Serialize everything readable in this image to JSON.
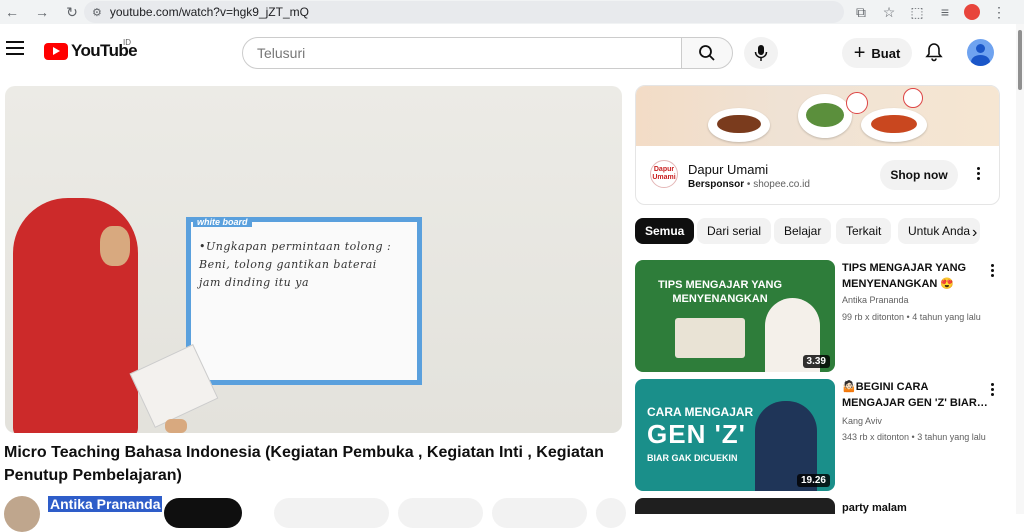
{
  "browser": {
    "url": "youtube.com/watch?v=hgk9_jZT_mQ"
  },
  "header": {
    "logo_text": "YouTube",
    "region": "ID",
    "search_placeholder": "Telusuri",
    "create_label": "Buat"
  },
  "video": {
    "title": "Micro Teaching Bahasa Indonesia (Kegiatan Pembuka , Kegiatan Inti , Kegiatan Penutup Pembelajaran)",
    "channel": "Antika Prananda",
    "whiteboard_label": "white board",
    "whiteboard_lines": [
      "•Ungkapan permintaan tolong :",
      "Beni, tolong gantikan baterai",
      "jam dinding itu ya"
    ]
  },
  "ad": {
    "logo_text": "Dapur Umami",
    "title": "Dapur Umami",
    "sponsor_label": "Bersponsor",
    "domain": "shopee.co.id",
    "cta": "Shop now"
  },
  "chips": [
    "Semua",
    "Dari serial",
    "Belajar",
    "Terkait",
    "Untuk Anda"
  ],
  "recommendations": [
    {
      "thumb_text": "TIPS MENGAJAR YANG MENYENANGKAN",
      "title": "TIPS MENGAJAR YANG MENYENANGKAN 😍",
      "channel": "Antika Prananda",
      "meta": "99 rb x ditonton • 4 tahun yang lalu",
      "duration": "3.39",
      "colors": {
        "bg": "#2e7d3a",
        "band": "#f5d33b"
      }
    },
    {
      "thumb_text_1": "CARA MENGAJAR",
      "thumb_text_2": "GEN 'Z'",
      "thumb_text_3": "BIAR GAK DICUEKIN",
      "title": "🤷🏻BEGINI CARA MENGAJAR GEN 'Z' BIAR…",
      "channel": "Kang Aviv",
      "meta": "343 rb x ditonton • 3 tahun yang lalu",
      "duration": "19.26",
      "colors": {
        "bg": "#1a8f8a",
        "band": "#f5d33b"
      }
    },
    {
      "title": "party malam"
    }
  ]
}
